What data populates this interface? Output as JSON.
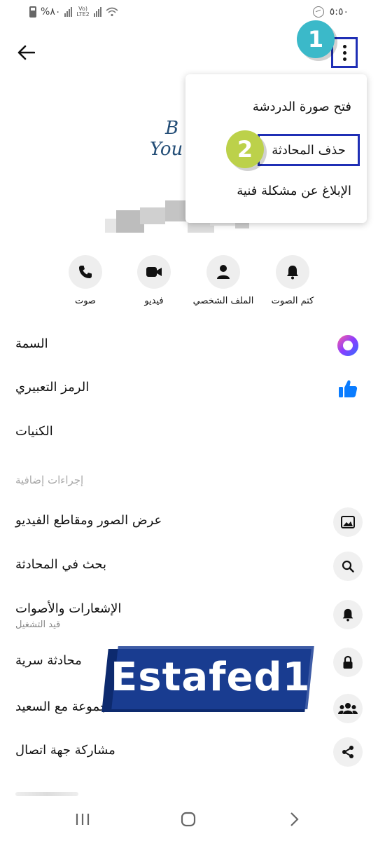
{
  "status_bar": {
    "battery_text": "%٨٠",
    "network": "LTE2",
    "time": "٥:٥٠"
  },
  "menu": {
    "open_chat_image": "فتح صورة الدردشة",
    "delete_conversation": "حذف المحادثة",
    "report_problem": "الإبلاغ عن مشكلة فنية"
  },
  "badges": {
    "one": "1",
    "two": "2"
  },
  "avatar": {
    "logo_line1": "B",
    "logo_line2": "You"
  },
  "actions": [
    {
      "label": "كتم الصوت",
      "icon": "bell-icon"
    },
    {
      "label": "الملف الشخصي",
      "icon": "person-icon"
    },
    {
      "label": "فيديو",
      "icon": "video-icon"
    },
    {
      "label": "صوت",
      "icon": "phone-icon"
    }
  ],
  "settings": {
    "theme": "السمة",
    "emoji": "الرمز التعبيري",
    "nicknames": "الكنيات",
    "more_actions_header": "إجراءات إضافية",
    "media": "عرض الصور ومقاطع الفيديو",
    "search": "بحث في المحادثة",
    "notifications": "الإشعارات والأصوات",
    "notifications_sub": "قيد التشغيل",
    "secret": "محادثة سرية",
    "group": "مجموعة مع السعيد",
    "share_contact": "مشاركة جهة اتصال"
  },
  "watermark": {
    "text": "Estafed1"
  },
  "colors": {
    "highlight_border": "#1f2fb5",
    "badge_one": "#3bb9c9",
    "badge_two": "#bcd14a",
    "messenger_blue": "#0a7cff",
    "theme_purple": "#8b3dff"
  }
}
